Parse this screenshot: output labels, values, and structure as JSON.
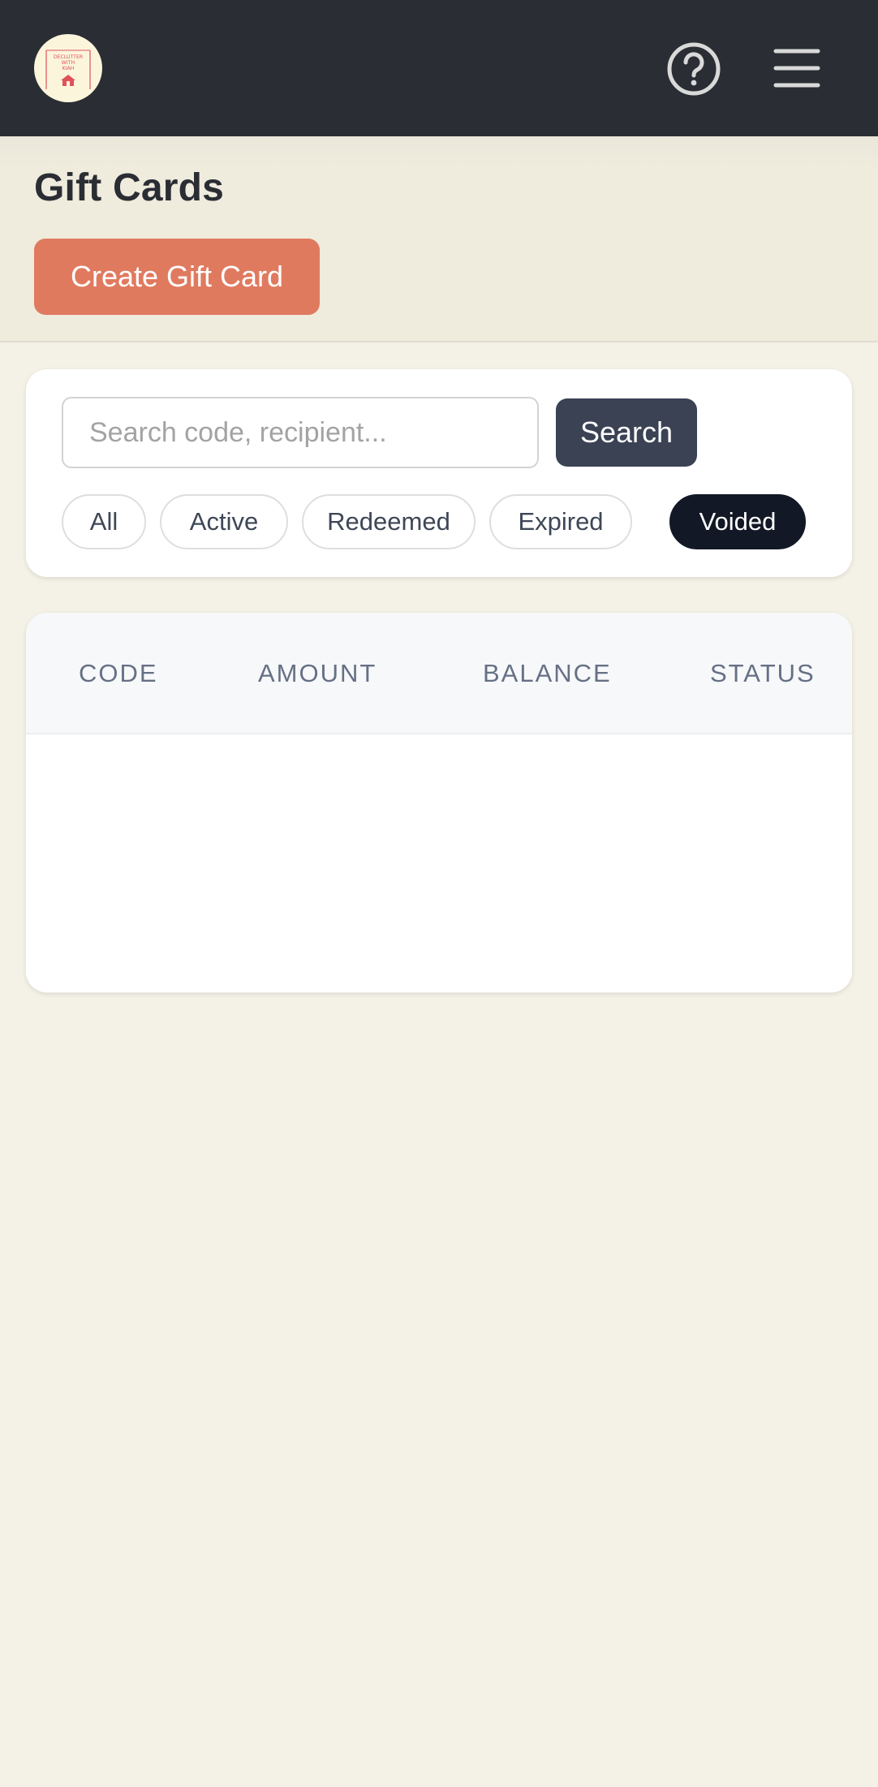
{
  "topbar": {
    "logo": {
      "lines": [
        "DECLUTTER",
        "WITH",
        "KIAH"
      ],
      "icon": "house-icon"
    },
    "help_icon": "question-circle-icon",
    "menu_icon": "hamburger-menu-icon"
  },
  "header": {
    "title": "Gift Cards",
    "create_button_label": "Create Gift Card"
  },
  "filters": {
    "search_placeholder": "Search code, recipient...",
    "search_value": "",
    "search_button_label": "Search",
    "status_chips": [
      {
        "label": "All",
        "selected": false
      },
      {
        "label": "Active",
        "selected": false
      },
      {
        "label": "Redeemed",
        "selected": false
      },
      {
        "label": "Expired",
        "selected": false
      },
      {
        "label": "Voided",
        "selected": true
      }
    ]
  },
  "table": {
    "columns": [
      "CODE",
      "AMOUNT",
      "BALANCE",
      "STATUS"
    ],
    "rows": []
  },
  "colors": {
    "topbar_bg": "#2a2d33",
    "page_bg": "#f4f1e6",
    "accent": "#e07a5f",
    "search_button": "#3a4254",
    "selected_chip": "#121826",
    "logo_red": "#e0525a"
  }
}
